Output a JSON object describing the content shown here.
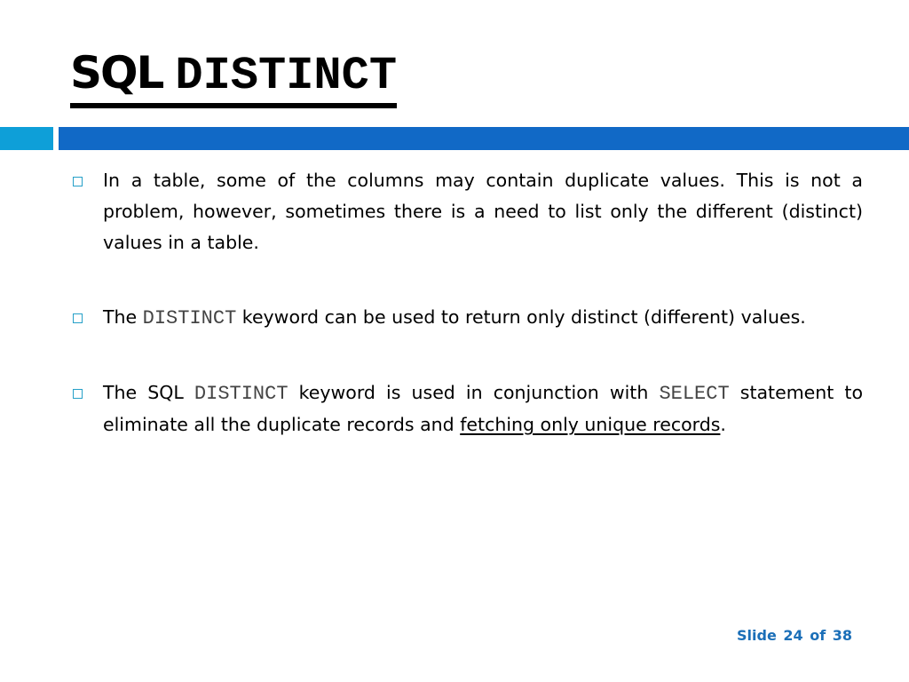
{
  "slide": {
    "title_sans": "SQL",
    "title_mono": "DISTINCT",
    "colors": {
      "accent_light": "#0e9fd8",
      "accent_dark": "#1169c6",
      "footer_text": "#1b6fb8",
      "bullet_box": "#26a0c8"
    },
    "bullets": [
      {
        "text": "In a table, some of the columns may contain duplicate values. This is not a problem, however, sometimes there is a need to list only the different (distinct) values in a table."
      },
      {
        "pre": "The ",
        "code": "DISTINCT",
        "post": " keyword can be used to return only distinct (different) values."
      },
      {
        "pre": "The SQL ",
        "code": "DISTINCT",
        "mid": " keyword is used in conjunction with ",
        "code2": "SELECT",
        "mid2": " statement to eliminate all the duplicate records and ",
        "underlined": "fetching only unique records",
        "post": "."
      }
    ],
    "footer": "Slide 24 of 38"
  }
}
